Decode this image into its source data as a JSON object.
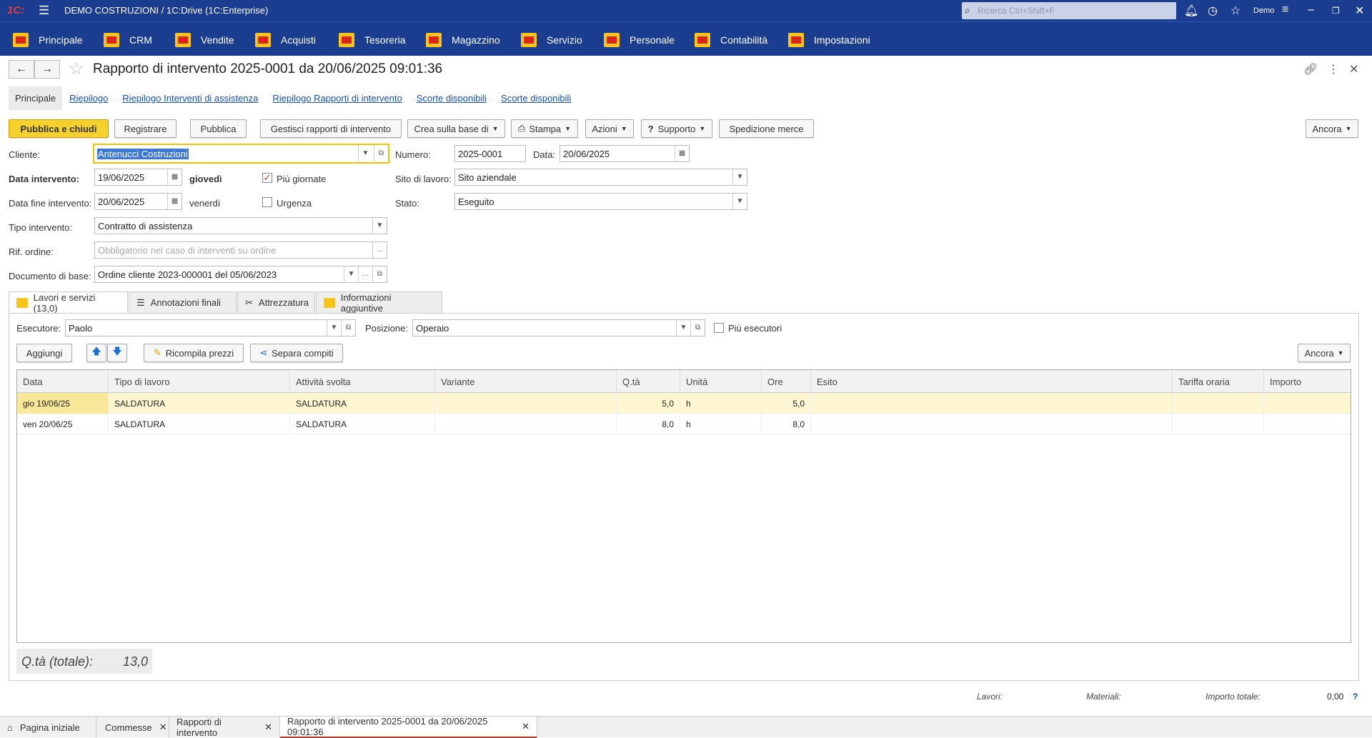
{
  "app": {
    "title": "DEMO COSTRUZIONI / 1C:Drive  (1C:Enterprise)",
    "search_placeholder": "Ricerca Ctrl+Shift+F",
    "user": "Demo"
  },
  "menu": [
    {
      "label": "Principale"
    },
    {
      "label": "CRM"
    },
    {
      "label": "Vendite"
    },
    {
      "label": "Acquisti"
    },
    {
      "label": "Tesoreria"
    },
    {
      "label": "Magazzino"
    },
    {
      "label": "Servizio"
    },
    {
      "label": "Personale"
    },
    {
      "label": "Contabilità"
    },
    {
      "label": "Impostazioni"
    }
  ],
  "document": {
    "title": "Rapporto di intervento 2025-0001 da 20/06/2025 09:01:36"
  },
  "top_tabs": [
    {
      "label": "Principale"
    },
    {
      "label": "Riepilogo"
    },
    {
      "label": "Riepilogo Interventi di assistenza"
    },
    {
      "label": "Riepilogo Rapporti di intervento"
    },
    {
      "label": "Scorte disponibili"
    },
    {
      "label": "Scorte disponibili"
    }
  ],
  "toolbar": {
    "publish_close": "Pubblica e chiudi",
    "register": "Registrare",
    "publish": "Pubblica",
    "manage_reports": "Gestisci rapporti di intervento",
    "create_based": "Crea sulla base di",
    "print": "Stampa",
    "actions": "Azioni",
    "support": "Supporto",
    "shipping": "Spedizione merce",
    "more": "Ancora"
  },
  "form": {
    "client_label": "Cliente:",
    "client_value": "Antenucci Costruzioni",
    "number_label": "Numero:",
    "number_value": "2025-0001",
    "date_label": "Data:",
    "date_value": "20/06/2025",
    "date_intervention_label": "Data intervento:",
    "date_intervention_value": "19/06/2025",
    "weekday1": "giovedì",
    "multi_days_label": "Più giornate",
    "site_label": "Sito di lavoro:",
    "site_value": "Sito aziendale",
    "date_end_label": "Data fine intervento:",
    "date_end_value": "20/06/2025",
    "weekday2": "venerdì",
    "urgency_label": "Urgenza",
    "status_label": "Stato:",
    "status_value": "Eseguito",
    "type_label": "Tipo intervento:",
    "type_value": "Contratto di assistenza",
    "order_ref_label": "Rif. ordine:",
    "order_ref_placeholder": "Obbligatorio nel caso di interventi su ordine",
    "base_doc_label": "Documento di base:",
    "base_doc_value": "Ordine cliente 2023-000001 del 05/06/2023"
  },
  "sub_tabs": [
    {
      "label": "Lavori e servizi (13,0)"
    },
    {
      "label": "Annotazioni finali"
    },
    {
      "label": "Attrezzatura"
    },
    {
      "label": "Informazioni aggiuntive"
    }
  ],
  "works": {
    "executor_label": "Esecutore:",
    "executor_value": "Paolo",
    "position_label": "Posizione:",
    "position_value": "Operaio",
    "more_executors_label": "Più esecutori",
    "add": "Aggiungi",
    "recalc": "Ricompila prezzi",
    "split": "Separa compiti",
    "more": "Ancora",
    "columns": [
      "Data",
      "Tipo di lavoro",
      "Attività svolta",
      "Variante",
      "Q.tà",
      "Unità",
      "Ore",
      "Esito",
      "Tariffa oraria",
      "Importo"
    ],
    "rows": [
      {
        "data": "gio 19/06/25",
        "tipo": "SALDATURA",
        "attivita": "SALDATURA",
        "variante": "",
        "qta": "5,0",
        "unita": "h",
        "ore": "5,0",
        "esito": "",
        "tariffa": "",
        "importo": ""
      },
      {
        "data": "ven 20/06/25",
        "tipo": "SALDATURA",
        "attivita": "SALDATURA",
        "variante": "",
        "qta": "8,0",
        "unita": "h",
        "ore": "8,0",
        "esito": "",
        "tariffa": "",
        "importo": ""
      }
    ],
    "total_label": "Q.tà (totale):",
    "total_value": "13,0"
  },
  "footer": {
    "lavori": "Lavori:",
    "materiali": "Materiali:",
    "importo_totale": "Importo totale:",
    "importo_value": "0,00",
    "help": "?"
  },
  "window_tabs": [
    {
      "label": "Pagina iniziale"
    },
    {
      "label": "Commesse"
    },
    {
      "label": "Rapporti di intervento"
    },
    {
      "label": "Rapporto di intervento 2025-0001 da 20/06/2025 09:01:36"
    }
  ]
}
